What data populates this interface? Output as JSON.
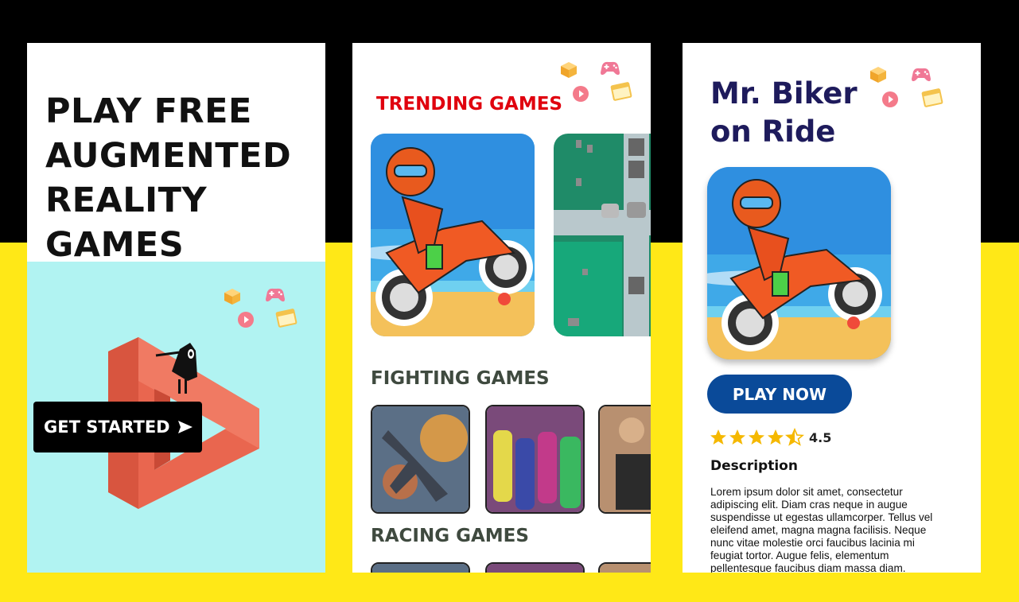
{
  "landing": {
    "headline": "PLAY FREE AUGMENTED REALITY GAMES",
    "cta_label": "GET STARTED"
  },
  "browse": {
    "trending_title": "TRENDING GAMES",
    "fighting_title": "FIGHTING GAMES",
    "racing_title": "RACING GAMES"
  },
  "detail": {
    "title_line1": "Mr. Biker",
    "title_line2": "on Ride",
    "play_label": "PLAY NOW",
    "rating": 4.5,
    "rating_text": "4.5",
    "description_heading": "Description",
    "description": "Lorem ipsum dolor sit amet, consectetur adipiscing elit. Diam cras neque in augue suspendisse ut egestas ullamcorper. Tellus vel eleifend amet, magna magna facilisis. Neque nunc vitae molestie orci faucibus lacinia mi feugiat tortor. Augue felis, elementum pellentesque faucibus diam massa diam."
  },
  "colors": {
    "trending": "#e0000e",
    "section": "#3f4a3f",
    "detail_title": "#1e1b5c",
    "play_button": "#0a4a99",
    "star": "#f5b800",
    "hero_bg": "#b1f3f2"
  },
  "icons": [
    "cube-icon",
    "gamepad-icon",
    "play-icon",
    "window-icon",
    "arrow-right-icon",
    "star-icon",
    "half-star-icon"
  ]
}
